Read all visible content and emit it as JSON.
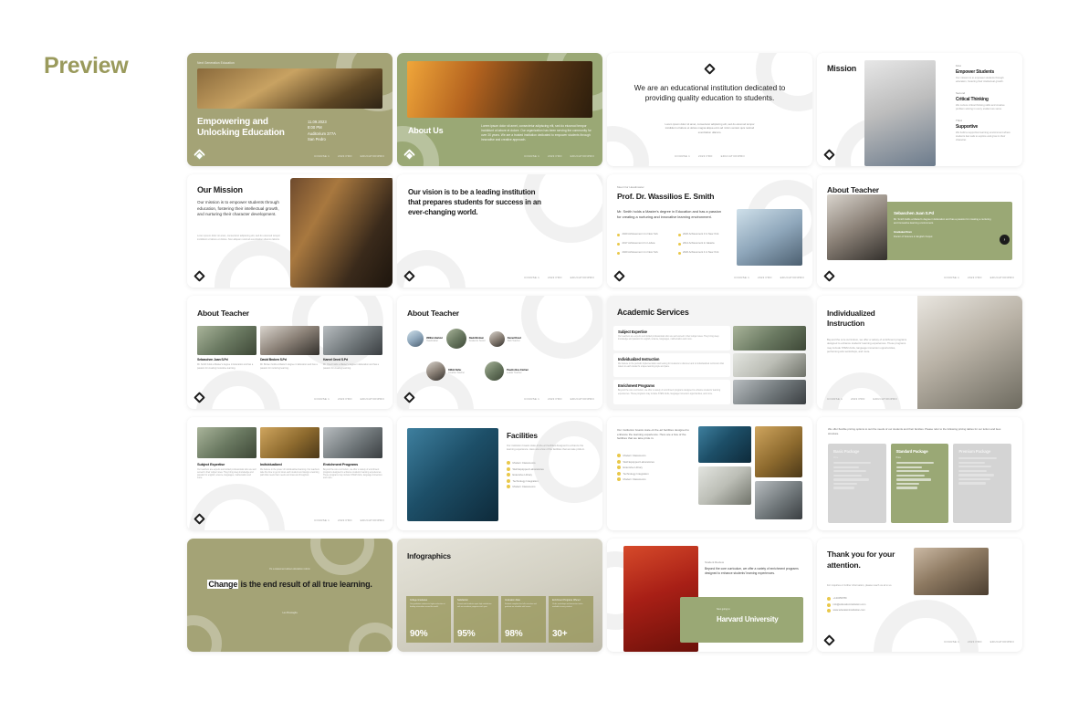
{
  "page": {
    "title": "Preview",
    "title_color": "#9a9a5c"
  },
  "theme": {
    "olive": "#a4a376",
    "sage": "#9aa875",
    "green": "#8ba368",
    "dark": "#1c1c1c",
    "yellow": "#e9c84a"
  },
  "footer": {
    "items": [
      "COURSE 1",
      "2023 PRO",
      "EDUCATIONPRO"
    ]
  },
  "slides": [
    {
      "n": 1,
      "name": "title-slide",
      "eyebrow": "Next Generation Education",
      "title": "Empowering and Unlocking Education",
      "meta": [
        "11.09.2023",
        "8:00 PM",
        "Auditorium 377A",
        "San Pedro"
      ]
    },
    {
      "n": 2,
      "name": "about-us-slide",
      "title": "About Us",
      "body": "Lorem ipsum dolor sit amet, consectetur adipiscing elit, sed do eiusmod tempor incididunt ut labore et dolore. Our organization has been serving the community for over 20 years. We are a trusted institution dedicated to empower students through innovative and creative approach."
    },
    {
      "n": 3,
      "name": "statement-slide",
      "headline": "We are an educational institution dedicated to providing quality education to students.",
      "body": "Lorem ipsum dolor sit amet, consectetur adipiscing elit, sed do eiusmod tempor incididunt ut labore et dolore magna aliqua enim ad minim veniam quis nostrud exercitation ullamco."
    },
    {
      "n": 4,
      "name": "mission-slide",
      "title": "Mission",
      "items": [
        {
          "label": "First",
          "heading": "Empower Students",
          "body": "Our mission is to empower students through education, fostering their intellectual growth."
        },
        {
          "label": "Second",
          "heading": "Critical Thinking",
          "body": "We nurture critical thinking skills and creative problem solving in every student we serve."
        },
        {
          "label": "Third",
          "heading": "Supportive",
          "body": "We build a supportive learning environment where students feel safe to explore and grow in their character."
        }
      ]
    },
    {
      "n": 5,
      "name": "our-mission-slide",
      "title": "Our Mission",
      "body": "Our mission is to empower students through education, fostering their intellectual growth, and nurturing their character development.",
      "caption": "Lorem ipsum dolor sit amet, consectetur adipiscing elit, sed do eiusmod tempor incididunt ut labore et dolore. Non aliquam nostrud exercitation ullamco laboris."
    },
    {
      "n": 6,
      "name": "vision-slide",
      "headline": "Our vision is to be a leading institution that prepares students for success in an ever-changing world."
    },
    {
      "n": 7,
      "name": "headmaster-slide",
      "eyebrow": "Meet Our Headmaster",
      "title": "Prof. Dr. Wassilios E. Smith",
      "body": "Mr. Smith holds a Master's degree in Education and has a passion for creating a nurturing and innovative learning environment.",
      "achievements": [
        "2020 Achievement 1 in New York",
        "2020 Achievement 3 in New York",
        "2017 Achievement 2 in Lisboa",
        "2014 Achievement in Jakarta",
        "2020 Achievement 1 in New York",
        "2020 Achievement 4 in New York"
      ]
    },
    {
      "n": 8,
      "name": "about-teacher-card-slide",
      "title": "About Teacher",
      "teacher_name": "Sebaschen Juan S.Pd",
      "teacher_body": "Mr. Smith holds a Master's degree in Education and has a passion for creating a nurturing and innovative learning environment.",
      "graduated_label": "Graduated from",
      "graduated_value": "Doctor of Science in English Output"
    },
    {
      "n": 9,
      "name": "about-teacher-three-slide",
      "title": "About Teacher",
      "teachers": [
        {
          "name": "Sebaschen Juan S.Pd",
          "body": "Mr. Smith holds a Master's degree in Education and has a passion for creating innovative learning."
        },
        {
          "name": "David Broken S.Pd",
          "body": "Mr. Broken holds a Master's degree in Education and has a passion for nurturing learning."
        },
        {
          "name": "Kamel Oned S.Pd",
          "body": "Mr. Oned holds a Master's degree in Education and has a passion for creating learning."
        }
      ]
    },
    {
      "n": 10,
      "name": "about-teacher-avatars-slide",
      "title": "About Teacher",
      "people": [
        {
          "name": "Wilfran Hartcut",
          "role": "Headmaster"
        },
        {
          "name": "David Broken",
          "role": "Academic Senior"
        },
        {
          "name": "Kamel Oned",
          "role": "Web Teacher"
        },
        {
          "name": "Kitfub Sahu",
          "role": "Creative Teacher"
        },
        {
          "name": "Peadro Bou Cartner",
          "role": "Leader Teacher"
        }
      ]
    },
    {
      "n": 11,
      "name": "academic-services-slide",
      "title": "Academic Services",
      "services": [
        {
          "heading": "Subject Expertise",
          "body": "Our teachers are experts and skilled professionals who are well versed in their subject area. They bring deep knowledge and passion for english, science, languages, mathematics and more."
        },
        {
          "heading": "Individualized Instruction",
          "body": "We believe in the periodic implementation and testing for students to discover and to individualized curriculum that caters to each student's unique learning style and pace."
        },
        {
          "heading": "Enrichment Programs",
          "body": "Beyond the core curriculum, we offer a variety of enrichment programs designed to enhance students' learning experiences. These programs may include STEM clubs, language immersion opportunities, and more."
        }
      ]
    },
    {
      "n": 12,
      "name": "individualized-instruction-slide",
      "title": "Individualized Instruction",
      "body": "Beyond the core curriculum, we offer a variety of enrichment programs designed to enhance students' learning experiences. These programs may include STEM clubs, language immersion opportunities, performing arts workshops, and more."
    },
    {
      "n": 13,
      "name": "three-column-services-slide",
      "columns": [
        {
          "heading": "Subject Expertise",
          "body": "Our teachers are experts and skilled professionals who are well versed in their subject area. They bring deep knowledge and passion for english, science, languages, mathematics and more."
        },
        {
          "heading": "Individualized",
          "body": "We believe in the power of individualized learning. Our teachers take the time to get to know each student and design a learning path that meets their needs and interests throughout."
        },
        {
          "heading": "Enrichment Programs",
          "body": "Beyond the core curriculum, we offer a variety of enrichment programs designed to enhance students' learning experiences. These programs may include STEM clubs, language immersion and more."
        }
      ]
    },
    {
      "n": 14,
      "name": "facilities-slide",
      "title": "Facilities",
      "body": "Our institution boasts state-of-the-art facilities designed to enhance the learning experience. Here are a few of the facilities that we take pride in.",
      "items": [
        "Modern Classrooms",
        "Well Equipped Laboratories",
        "Extensive Library",
        "Technology Integration",
        "Modern Classrooms"
      ]
    },
    {
      "n": 15,
      "name": "facilities-photos-slide",
      "body": "Our institution boasts state-of-the-art facilities designed to enhance the learning experience. Here are a few of the facilities that we take pride in.",
      "items": [
        "Modern Classrooms",
        "Well Equipped Laboratories",
        "Extensive Library",
        "Technology Integration",
        "Modern Classrooms"
      ]
    },
    {
      "n": 16,
      "name": "pricing-slide",
      "intro": "We offer flexible pricing options to suit the needs of our students and their families. Please refer to the following pricing tables for our tuition and fees structure.",
      "packages": [
        {
          "name": "Basic Package",
          "label": "Price",
          "rows": [
            {
              "value": "$8,000",
              "text": "per academic year"
            },
            {
              "value": "Registration",
              "text": ""
            },
            {
              "value": "$700",
              "text": "(One-time payment)"
            },
            {
              "value": "Annual Activity",
              "text": ""
            },
            {
              "value": "$300",
              "text": "per academic year"
            },
            {
              "value": "Payment Options",
              "text": ""
            },
            {
              "value": "Bi-Monthly",
              "text": ""
            }
          ]
        },
        {
          "name": "Standard Package",
          "label": "Price",
          "highlighted": true,
          "rows": [
            {
              "value": "$9,500",
              "text": "per academic year"
            },
            {
              "value": "Registration",
              "text": ""
            },
            {
              "value": "$750",
              "text": "(One-time payment)"
            },
            {
              "value": "Annual Activity",
              "text": ""
            },
            {
              "value": "$400",
              "text": "per academic year"
            },
            {
              "value": "Payment Options",
              "text": ""
            },
            {
              "value": "Multi-Annual",
              "text": ""
            }
          ]
        },
        {
          "name": "Premium Package",
          "label": "Price",
          "rows": [
            {
              "value": "$11,000",
              "text": "per academic year"
            },
            {
              "value": "$900",
              "text": "(One-time payment)"
            },
            {
              "value": "$800",
              "text": "per academic year"
            },
            {
              "value": "$500",
              "text": "per academic year"
            },
            {
              "value": "Personalized Tutoring",
              "text": ""
            },
            {
              "value": "College Counseling",
              "text": ""
            }
          ]
        }
      ]
    },
    {
      "n": 17,
      "name": "quote-slide",
      "eyebrow": "It's a statement about education reform",
      "quote_highlight": "Change",
      "quote_rest": " is the end result of all true learning.",
      "attribution": "Leo Buscaglia"
    },
    {
      "n": 18,
      "name": "infographics-slide",
      "title": "Infographics",
      "stats": [
        {
          "label": "College Graduates",
          "body": "Our graduates continue to higher education at leading universities around the world.",
          "value": "90%"
        },
        {
          "label": "Satisfaction",
          "body": "Parents and students report high satisfaction with our academic programs each year.",
          "value": "95%"
        },
        {
          "label": "Graduation Rate",
          "body": "Students complete the full curriculum and graduate on schedule with honors.",
          "value": "98%"
        },
        {
          "label": "Enrichment Programs Offered",
          "body": "Clubs, workshops and immersion tracks available to every student.",
          "value": "30+"
        }
      ]
    },
    {
      "n": 19,
      "name": "testimonial-slide",
      "eyebrow": "Student Review",
      "body": "Beyond the core curriculum, we offer a variety of enrichment programs designed to enhance students' learning experiences.",
      "school_label": "Now going to",
      "school": "Harvard University"
    },
    {
      "n": 20,
      "name": "thank-you-slide",
      "title": "Thank you for your attention.",
      "body": "For inquiries or further information, please reach us at to us.",
      "contacts": [
        "+123456789",
        "info@educationinstitution.com",
        "www.educationinstitution.com"
      ]
    }
  ]
}
